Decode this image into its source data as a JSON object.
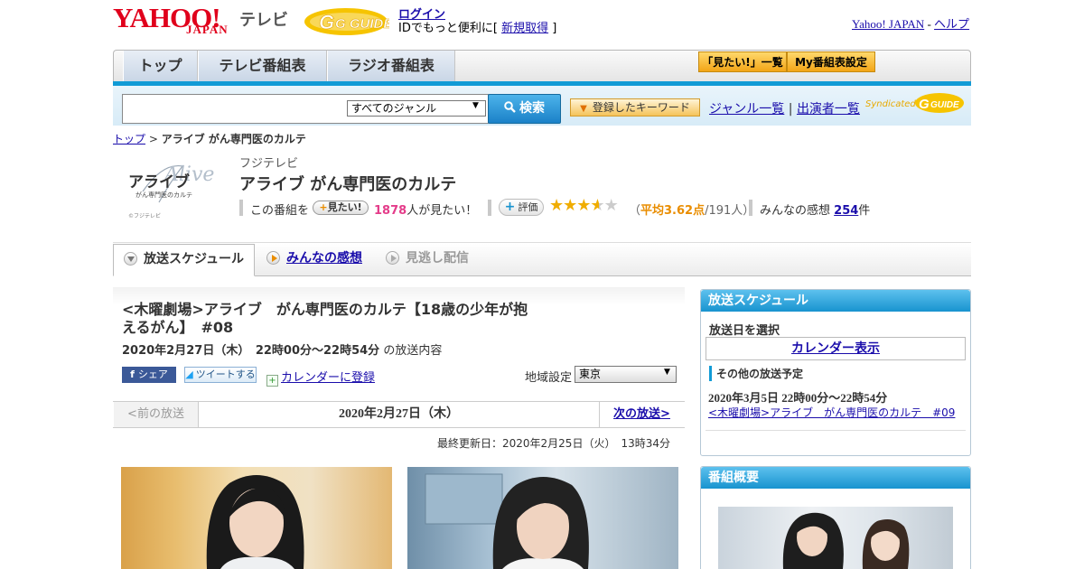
{
  "header": {
    "yahoo_logo": "YAHOO!",
    "yahoo_logo_sub": "JAPAN",
    "tv_label": "テレビ",
    "gguide_logo": "G GUIDE",
    "login_link": "ログイン",
    "login_msg_prefix": "IDでもっと便利に[ ",
    "signup_link": "新規取得",
    "login_msg_suffix": " ]",
    "yahoo_japan_link": "Yahoo! JAPAN",
    "sep": " - ",
    "help_link": "ヘルプ"
  },
  "nav": {
    "tabs": [
      {
        "label": "トップ"
      },
      {
        "label": "テレビ番組表"
      },
      {
        "label": "ラジオ番組表"
      }
    ],
    "mitai_list": "「見たい!」一覧",
    "my_bangumi": "My番組表設定"
  },
  "search": {
    "placeholder": "",
    "genre_selected": "すべてのジャンル",
    "button": "検索",
    "keyword_button": "登録したキーワード",
    "genre_list": "ジャンル一覧",
    "divider": " | ",
    "performer_list": "出演者一覧",
    "syndicated": "Syndicated",
    "syndicated_logo": "GUIDE"
  },
  "breadcrumb": {
    "top": "トップ",
    "sep": " > ",
    "current": "アライブ がん専門医のカルテ"
  },
  "program": {
    "logo_title": "アライブ",
    "logo_sub": "がん専門医のカルテ",
    "logo_script": "Alive",
    "logo_credit": "©フジテレビ",
    "station": "フジテレビ",
    "title": "アライブ がん専門医のカルテ",
    "mitai_prefix": "この番組を",
    "mitai_button": "見たい!",
    "mitai_count": "1878",
    "mitai_suffix": "人が見たい！",
    "eval_button": "評価",
    "rating": 3.62,
    "avg_open": "（",
    "avg_label": "平均3.62点",
    "avg_people": "/191人）",
    "impressions_label": "みんなの感想",
    "impressions_count": "254",
    "impressions_unit": "件"
  },
  "subtabs": {
    "schedule": "放送スケジュール",
    "minna": "みんなの感想",
    "minogashi": "見逃し配信"
  },
  "episode": {
    "title": "<木曜劇場>アライブ　がん専門医のカルテ【18歳の少年が抱えるがん】　#08",
    "datetime": "2020年2月27日（木）　22時00分～22時54分",
    "datetime_suffix": "の放送内容",
    "share_fb": "シェア",
    "share_tw": "ツイートする",
    "calendar_register": "カレンダーに登録",
    "region_label": "地域設定",
    "region_value": "東京",
    "prev": "<前の放送",
    "current_date": "2020年2月27日（木）",
    "next": "次の放送>",
    "updated": "最終更新日：2020年2月25日（火）　13時34分"
  },
  "sidebar": {
    "schedule_title": "放送スケジュール",
    "select_date": "放送日を選択",
    "calendar_button": "カレンダー表示",
    "other_label": "その他の放送予定",
    "other_date": "2020年3月5日  22時00分～22時54分",
    "other_link": "<木曜劇場>アライブ　がん専門医のカルテ　#09",
    "overview_title": "番組概要"
  }
}
